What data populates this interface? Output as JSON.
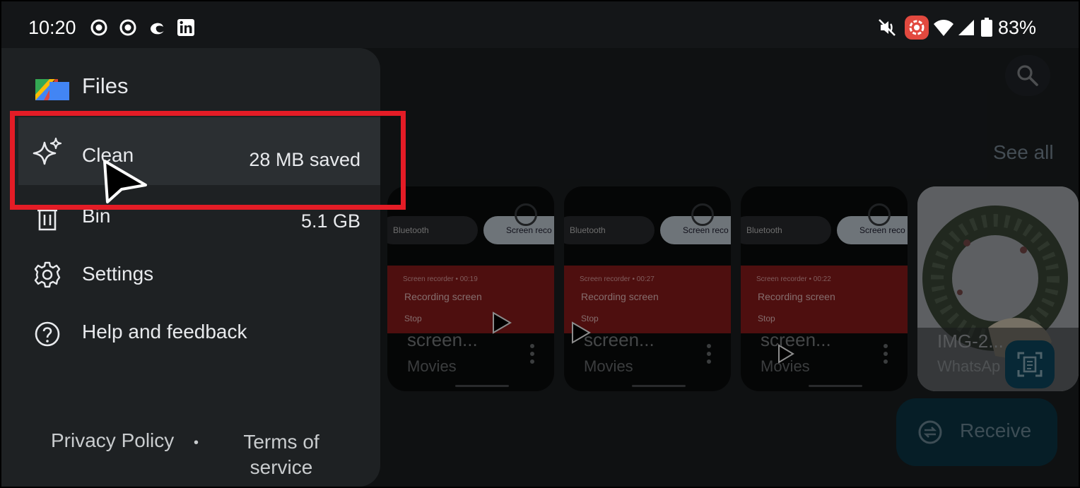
{
  "status_bar": {
    "time": "10:20",
    "left_icons": [
      "screen-record-icon",
      "screen-record-icon",
      "edge-icon",
      "linkedin-icon"
    ],
    "right_icons": [
      "mute-icon",
      "recording-indicator-icon",
      "wifi-icon",
      "signal-icon",
      "battery-icon"
    ],
    "battery": "83%"
  },
  "drawer": {
    "app_name": "Files",
    "items": [
      {
        "label": "Clean",
        "trail": "28 MB saved",
        "icon": "sparkle-icon"
      },
      {
        "label": "Bin",
        "trail": "5.1 GB",
        "icon": "trash-icon"
      },
      {
        "label": "Settings",
        "trail": "",
        "icon": "gear-icon"
      },
      {
        "label": "Help and feedback",
        "trail": "",
        "icon": "help-icon"
      }
    ],
    "footer": {
      "privacy": "Privacy Policy",
      "separator": "•",
      "terms": "Terms of service"
    }
  },
  "background": {
    "see_all": "See all",
    "thumbnails": [
      {
        "name": "screen...",
        "sub": "Movies",
        "pill1": "Bluetooth",
        "pill2": "Screen reco",
        "rec_meta": "Screen recorder • 00:19",
        "rec_title": "Recording screen",
        "rec_stop": "Stop"
      },
      {
        "name": "screen...",
        "sub": "Movies",
        "pill1": "Bluetooth",
        "pill2": "Screen reco",
        "rec_meta": "Screen recorder • 00:27",
        "rec_title": "Recording screen",
        "rec_stop": "Stop"
      },
      {
        "name": "screen...",
        "sub": "Movies",
        "pill1": "Bluetooth",
        "pill2": "Screen reco",
        "rec_meta": "Screen recorder • 00:22",
        "rec_title": "Recording screen",
        "rec_stop": "Stop"
      },
      {
        "name": "IMG-2...",
        "sub": "WhatsAp"
      }
    ],
    "receive_label": "Receive"
  },
  "colors": {
    "highlight_border": "#e41c26",
    "drawer_bg": "#1e2123",
    "recording_red": "#8e1c1c"
  }
}
